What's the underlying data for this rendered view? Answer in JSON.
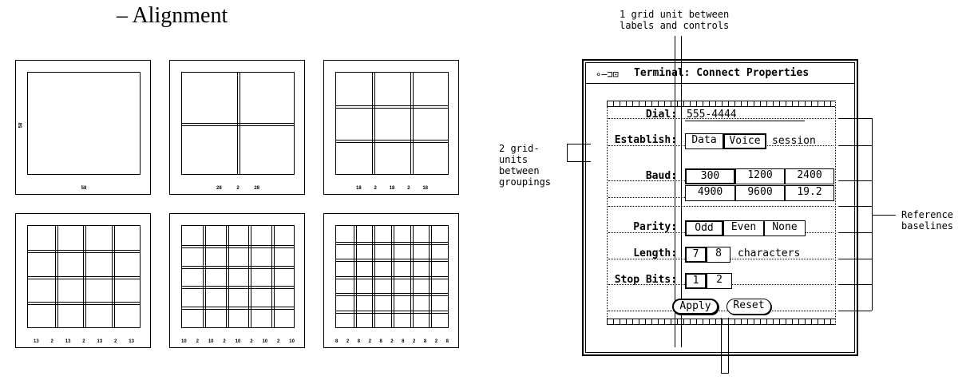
{
  "heading": "– Alignment",
  "grid_panels": [
    {
      "side_label": "58",
      "bottom_labels": [
        "58"
      ]
    },
    {
      "bottom_labels": [
        "28",
        "2",
        "28"
      ]
    },
    {
      "bottom_labels": [
        "18",
        "2",
        "18",
        "2",
        "18"
      ]
    },
    {
      "bottom_labels": [
        "13",
        "2",
        "13",
        "2",
        "13",
        "2",
        "13"
      ]
    },
    {
      "bottom_labels": [
        "10",
        "2",
        "10",
        "2",
        "10",
        "2",
        "10",
        "2",
        "10"
      ]
    },
    {
      "bottom_labels": [
        "8",
        "2",
        "8",
        "2",
        "8",
        "2",
        "8",
        "2",
        "8",
        "2",
        "8"
      ]
    }
  ],
  "annotations": {
    "top": "1 grid unit between\nlabels and controls",
    "left": "2 grid-\nunits\nbetween\ngroupings",
    "right": "Reference\nbaselines"
  },
  "dialog": {
    "title": "Terminal: Connect Properties",
    "dial_label": "Dial:",
    "dial_value": "555-4444",
    "establish_label": "Establish:",
    "establish_options": [
      "Data",
      "Voice"
    ],
    "establish_suffix": "session",
    "baud_label": "Baud:",
    "baud_options": [
      "300",
      "1200",
      "2400",
      "4900",
      "9600",
      "19.2"
    ],
    "parity_label": "Parity:",
    "parity_options": [
      "Odd",
      "Even",
      "None"
    ],
    "length_label": "Length:",
    "length_options": [
      "7",
      "8"
    ],
    "length_suffix": "characters",
    "stopbits_label": "Stop Bits:",
    "stopbits_options": [
      "1",
      "2"
    ],
    "apply_label": "Apply",
    "reset_label": "Reset"
  }
}
